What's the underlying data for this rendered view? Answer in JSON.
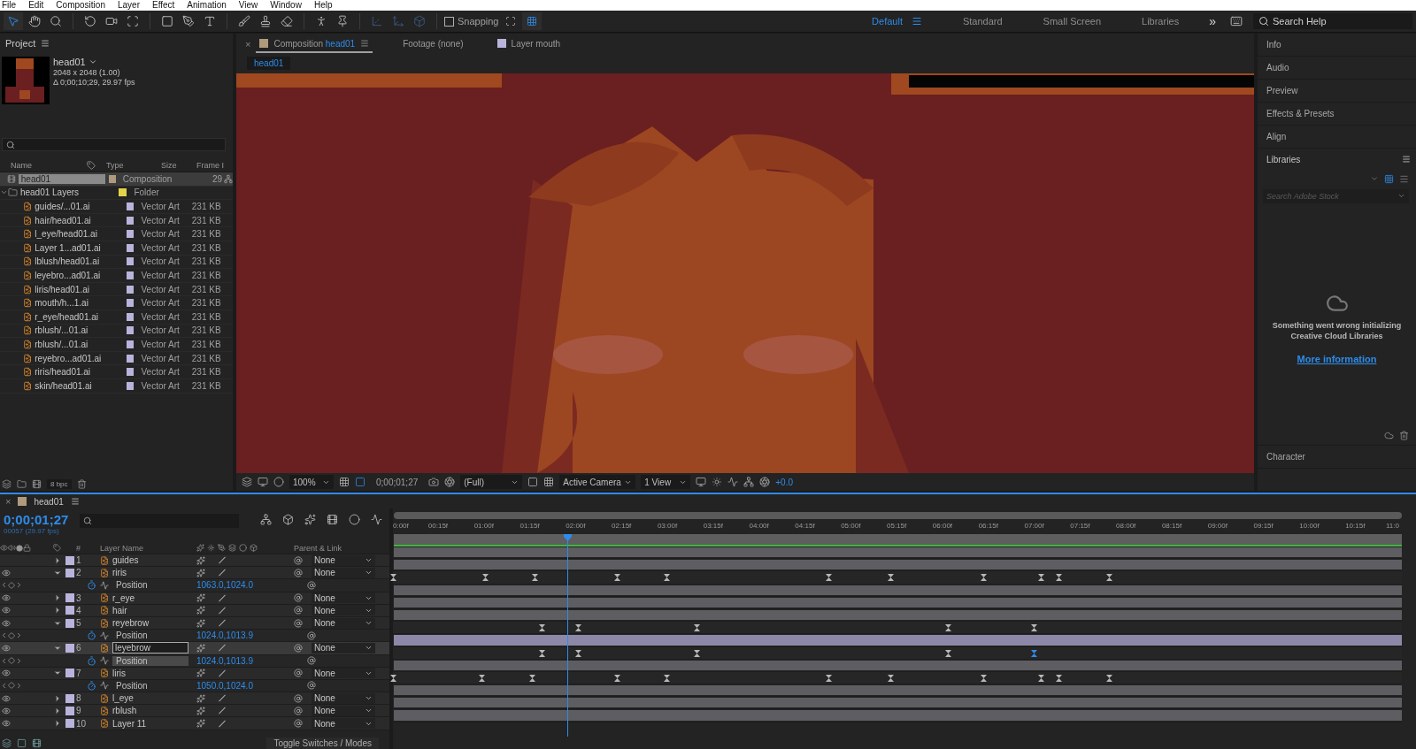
{
  "menu": [
    "File",
    "Edit",
    "Composition",
    "Layer",
    "Effect",
    "Animation",
    "View",
    "Window",
    "Help"
  ],
  "toolbar": {
    "snapping": {
      "label": "Snapping",
      "checked": false
    },
    "workspaces": [
      {
        "label": "Default",
        "selected": true
      },
      {
        "label": "Standard",
        "selected": false
      },
      {
        "label": "Small Screen",
        "selected": false
      },
      {
        "label": "Libraries",
        "selected": false
      }
    ],
    "overflow": "»",
    "search": {
      "placeholder": "Search Help"
    }
  },
  "project": {
    "title": "Project",
    "comp": {
      "name": "head01",
      "size": "2048 x 2048 (1.00)",
      "duration": "Δ 0;00;10;29, 29.97 fps"
    },
    "columns": [
      "Name",
      "Type",
      "Size",
      "Frame I"
    ],
    "items": [
      {
        "kind": "comp",
        "name": "head01",
        "color": "#b09a7c",
        "type": "Composition",
        "frame": "29",
        "selected": true
      },
      {
        "kind": "folder",
        "name": "head01 Layers",
        "color": "#e2d24a",
        "type": "Folder",
        "expanded": true,
        "selected": false,
        "children": [
          {
            "kind": "file",
            "name": "guides/...01.ai",
            "color": "#b8b4dc",
            "type": "Vector Art",
            "size": "231 KB",
            "selected": false
          },
          {
            "kind": "file",
            "name": "hair/head01.ai",
            "color": "#b8b4dc",
            "type": "Vector Art",
            "size": "231 KB",
            "selected": false
          },
          {
            "kind": "file",
            "name": "l_eye/head01.ai",
            "color": "#b8b4dc",
            "type": "Vector Art",
            "size": "231 KB",
            "selected": false
          },
          {
            "kind": "file",
            "name": "Layer 1...ad01.ai",
            "color": "#b8b4dc",
            "type": "Vector Art",
            "size": "231 KB",
            "selected": false
          },
          {
            "kind": "file",
            "name": "lblush/head01.ai",
            "color": "#b8b4dc",
            "type": "Vector Art",
            "size": "231 KB",
            "selected": false
          },
          {
            "kind": "file",
            "name": "leyebro...ad01.ai",
            "color": "#b8b4dc",
            "type": "Vector Art",
            "size": "231 KB",
            "selected": false
          },
          {
            "kind": "file",
            "name": "liris/head01.ai",
            "color": "#b8b4dc",
            "type": "Vector Art",
            "size": "231 KB",
            "selected": false
          },
          {
            "kind": "file",
            "name": "mouth/h...1.ai",
            "color": "#b8b4dc",
            "type": "Vector Art",
            "size": "231 KB",
            "selected": false
          },
          {
            "kind": "file",
            "name": "r_eye/head01.ai",
            "color": "#b8b4dc",
            "type": "Vector Art",
            "size": "231 KB",
            "selected": false
          },
          {
            "kind": "file",
            "name": "rblush/...01.ai",
            "color": "#b8b4dc",
            "type": "Vector Art",
            "size": "231 KB",
            "selected": false
          },
          {
            "kind": "file",
            "name": "rblush/...01.ai",
            "color": "#b8b4dc",
            "type": "Vector Art",
            "size": "231 KB",
            "selected": false
          },
          {
            "kind": "file",
            "name": "reyebro...ad01.ai",
            "color": "#b8b4dc",
            "type": "Vector Art",
            "size": "231 KB",
            "selected": false
          },
          {
            "kind": "file",
            "name": "riris/head01.ai",
            "color": "#b8b4dc",
            "type": "Vector Art",
            "size": "231 KB",
            "selected": false
          },
          {
            "kind": "file",
            "name": "skin/head01.ai",
            "color": "#b8b4dc",
            "type": "Vector Art",
            "size": "231 KB",
            "selected": false
          }
        ]
      }
    ],
    "bpc": "8 bpc"
  },
  "viewer": {
    "close": "×",
    "tabs": [
      {
        "label": "Composition",
        "name": "head01",
        "color": "#b09a7c",
        "selected": true
      },
      {
        "label": "Footage (none)",
        "selected": false
      },
      {
        "label": "Layer mouth",
        "color": "#b8b4dc",
        "selected": false
      }
    ],
    "breadcrumb": "head01",
    "zoom": "100%",
    "time": "0;00;01;27",
    "resolution": "(Full)",
    "camera": "Active Camera",
    "views": "1 View",
    "exposure": "+0.0"
  },
  "right": {
    "panels": [
      "Info",
      "Audio",
      "Preview",
      "Effects & Presets",
      "Align"
    ],
    "libraries": {
      "title": "Libraries",
      "search_placeholder": "Search Adobe Stock",
      "message": "Something went wrong initializing Creative Cloud Libraries",
      "link": "More information"
    },
    "after": [
      "Character"
    ]
  },
  "timeline": {
    "close": "×",
    "tab": "head01",
    "time": "0;00;01;27",
    "frames": "00057 (29.97 fps)",
    "columns": {
      "number": "#",
      "name": "Layer Name",
      "parent": "Parent & Link"
    },
    "ruler": [
      "0:00f",
      "00:15f",
      "01:00f",
      "01:15f",
      "02:00f",
      "02:15f",
      "03:00f",
      "03:15f",
      "04:00f",
      "04:15f",
      "05:00f",
      "05:15f",
      "06:00f",
      "06:15f",
      "07:00f",
      "07:15f",
      "08:00f",
      "08:15f",
      "09:00f",
      "09:15f",
      "10:00f",
      "10:15f",
      "11:0"
    ],
    "rows": [
      {
        "kind": "layer",
        "number": "1",
        "name": "guides",
        "expanded": false,
        "visible": false,
        "selected": false,
        "color": "#b8b4dc",
        "parent": "None"
      },
      {
        "kind": "layer",
        "number": "2",
        "name": "riris",
        "expanded": true,
        "visible": true,
        "selected": false,
        "color": "#b8b4dc",
        "parent": "None"
      },
      {
        "kind": "property",
        "name": "Position",
        "value": "1063.0,1024.0",
        "selected": false,
        "keyframes": [
          {
            "level": 0.0,
            "selected": false
          },
          {
            "level": 0.091,
            "selected": false
          },
          {
            "level": 0.14,
            "selected": false
          },
          {
            "level": 0.222,
            "selected": false
          },
          {
            "level": 0.271,
            "selected": false
          },
          {
            "level": 0.432,
            "selected": false
          },
          {
            "level": 0.493,
            "selected": false
          },
          {
            "level": 0.585,
            "selected": false
          },
          {
            "level": 0.642,
            "selected": false
          },
          {
            "level": 0.66,
            "selected": false
          },
          {
            "level": 0.71,
            "selected": false
          }
        ]
      },
      {
        "kind": "layer",
        "number": "3",
        "name": "r_eye",
        "expanded": false,
        "visible": true,
        "selected": false,
        "color": "#b8b4dc",
        "parent": "None"
      },
      {
        "kind": "layer",
        "number": "4",
        "name": "hair",
        "expanded": false,
        "visible": true,
        "selected": false,
        "color": "#b8b4dc",
        "parent": "None"
      },
      {
        "kind": "layer",
        "number": "5",
        "name": "reyebrow",
        "expanded": true,
        "visible": true,
        "selected": false,
        "color": "#b8b4dc",
        "parent": "None"
      },
      {
        "kind": "property",
        "name": "Position",
        "value": "1024.0,1013.9",
        "selected": false,
        "keyframes": [
          {
            "level": 0.147,
            "selected": false
          },
          {
            "level": 0.183,
            "selected": false
          },
          {
            "level": 0.301,
            "selected": false
          },
          {
            "level": 0.55,
            "selected": false
          },
          {
            "level": 0.635,
            "selected": false
          }
        ]
      },
      {
        "kind": "layer",
        "number": "6",
        "name": "leyebrow",
        "expanded": true,
        "visible": true,
        "selected": true,
        "color": "#b8b4dc",
        "parent": "None"
      },
      {
        "kind": "property",
        "name": "Position",
        "value": "1024.0,1013.9",
        "selected": true,
        "keyframes": [
          {
            "level": 0.147,
            "selected": false
          },
          {
            "level": 0.183,
            "selected": false
          },
          {
            "level": 0.301,
            "selected": false
          },
          {
            "level": 0.55,
            "selected": false
          },
          {
            "level": 0.635,
            "selected": true
          }
        ]
      },
      {
        "kind": "layer",
        "number": "7",
        "name": "liris",
        "expanded": true,
        "visible": true,
        "selected": false,
        "color": "#b8b4dc",
        "parent": "None"
      },
      {
        "kind": "property",
        "name": "Position",
        "value": "1050.0,1024.0",
        "selected": false,
        "keyframes": [
          {
            "level": 0.0,
            "selected": false
          },
          {
            "level": 0.088,
            "selected": false
          },
          {
            "level": 0.138,
            "selected": false
          },
          {
            "level": 0.222,
            "selected": false
          },
          {
            "level": 0.271,
            "selected": false
          },
          {
            "level": 0.432,
            "selected": false
          },
          {
            "level": 0.493,
            "selected": false
          },
          {
            "level": 0.585,
            "selected": false
          },
          {
            "level": 0.642,
            "selected": false
          },
          {
            "level": 0.66,
            "selected": false
          },
          {
            "level": 0.71,
            "selected": false
          }
        ]
      },
      {
        "kind": "layer",
        "number": "8",
        "name": "l_eye",
        "expanded": false,
        "visible": true,
        "selected": false,
        "color": "#b8b4dc",
        "parent": "None"
      },
      {
        "kind": "layer",
        "number": "9",
        "name": "rblush",
        "expanded": false,
        "visible": true,
        "selected": false,
        "color": "#b8b4dc",
        "parent": "None"
      },
      {
        "kind": "layer",
        "number": "10",
        "name": "Layer 11",
        "expanded": false,
        "visible": true,
        "selected": false,
        "color": "#b8b4dc",
        "parent": "None"
      }
    ],
    "toggle": "Toggle Switches / Modes"
  }
}
